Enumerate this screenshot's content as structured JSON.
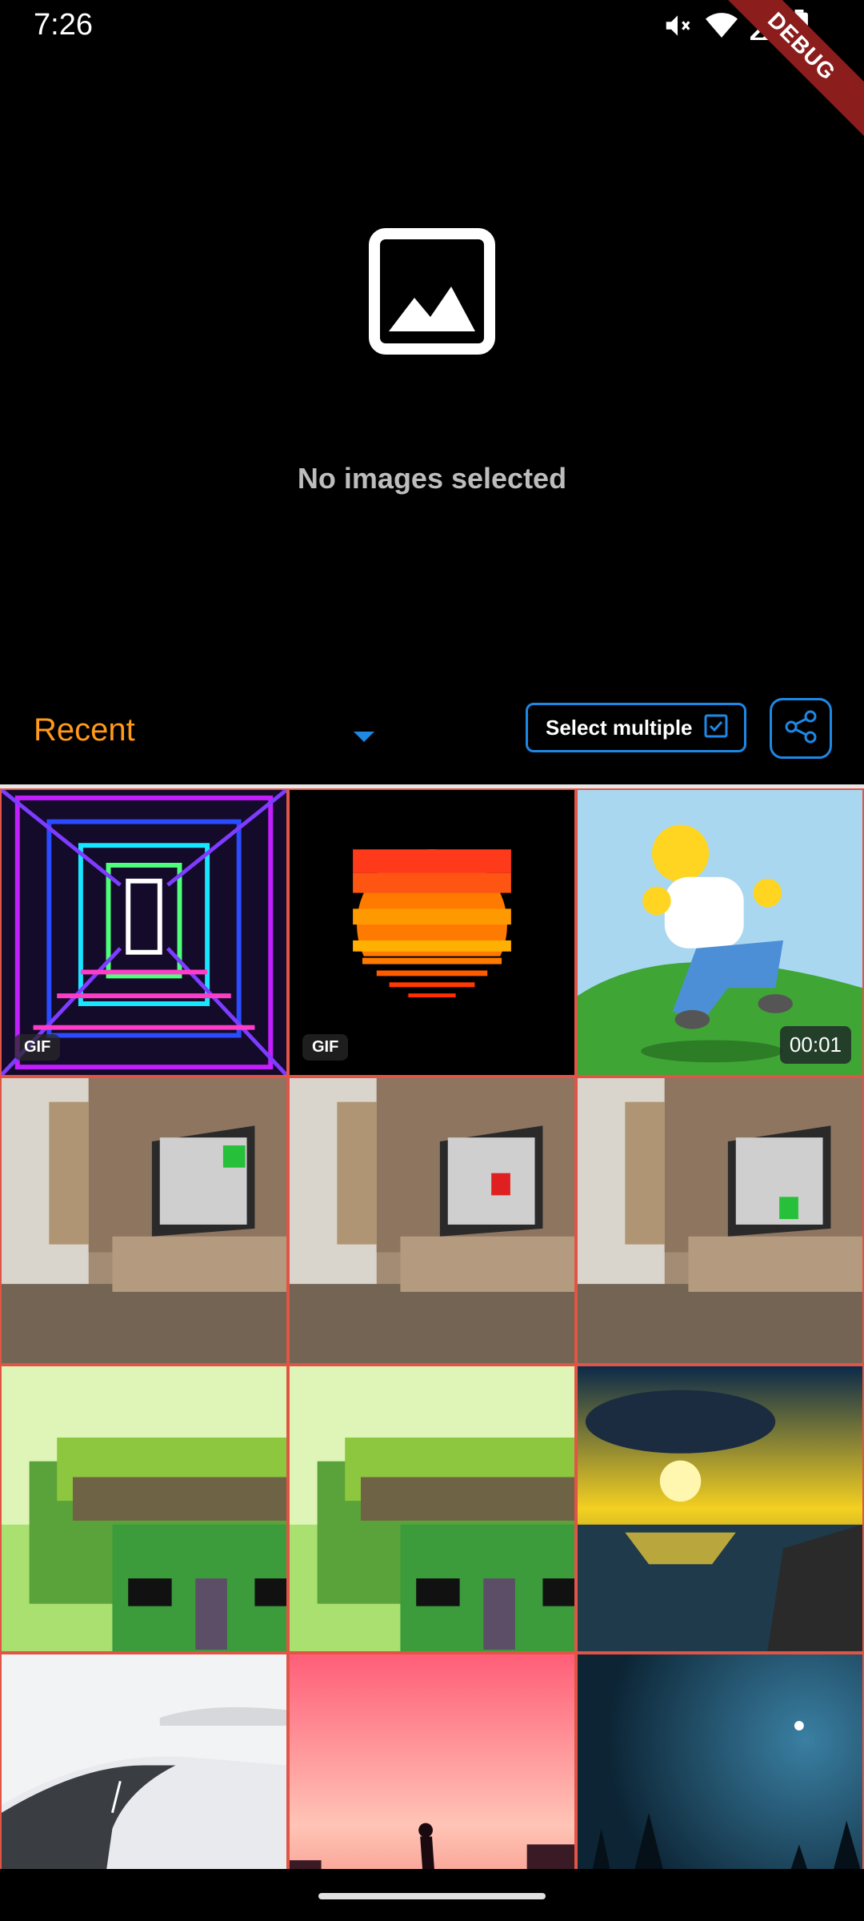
{
  "status_bar": {
    "time": "7:26",
    "icons": [
      "mute-icon",
      "wifi-icon",
      "signal-icon",
      "battery-icon"
    ]
  },
  "debug_banner": "DEBUG",
  "preview": {
    "placeholder_icon": "image-icon",
    "empty_text": "No images selected"
  },
  "toolbar": {
    "album": "Recent",
    "select_multiple": "Select multiple",
    "share_icon": "share-icon"
  },
  "colors": {
    "accent": "#1e88e5",
    "album_text": "#ff9a1a",
    "tile_border": "#e05545"
  },
  "grid": {
    "items": [
      {
        "type": "gif",
        "badge": "GIF"
      },
      {
        "type": "gif",
        "badge": "GIF"
      },
      {
        "type": "video",
        "duration": "00:01"
      },
      {
        "type": "image"
      },
      {
        "type": "image"
      },
      {
        "type": "image"
      },
      {
        "type": "image"
      },
      {
        "type": "image"
      },
      {
        "type": "image"
      },
      {
        "type": "image"
      },
      {
        "type": "image"
      },
      {
        "type": "image"
      }
    ]
  }
}
